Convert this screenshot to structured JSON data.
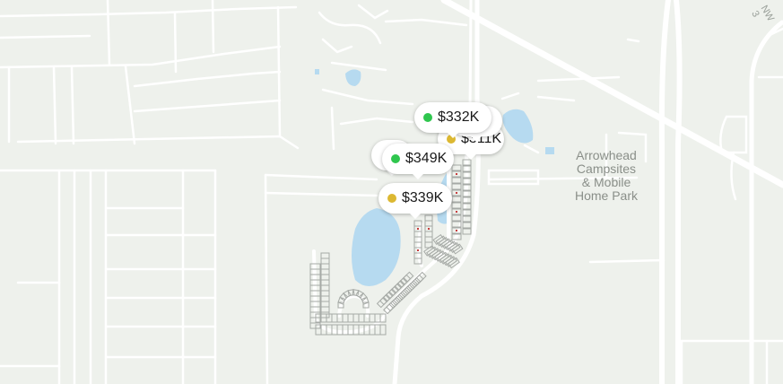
{
  "map": {
    "place_label_lines": [
      "Arrowhead",
      "Campsites",
      "& Mobile",
      "Home Park"
    ],
    "road_label": "NW 3",
    "colors": {
      "land": "#eef1ec",
      "road": "#ffffff",
      "water": "#b6daf0",
      "lot": "#a6aaa6",
      "lot_marker": "#c63d3d",
      "dot_green": "#2fc64e",
      "dot_yellow": "#dcb832"
    }
  },
  "pins": [
    {
      "price": "$332K",
      "dot_color": "#2fc64e"
    },
    {
      "price": "$339K",
      "dot_color": "#dcb832"
    },
    {
      "price": "$349K",
      "dot_color": "#2fc64e"
    },
    {
      "price": "$311K",
      "dot_color": "#dcb832"
    }
  ]
}
